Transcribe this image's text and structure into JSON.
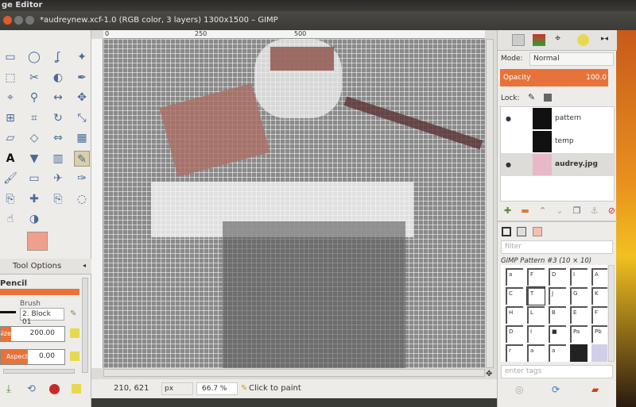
{
  "topbar": {
    "title": "ge Editor"
  },
  "window": {
    "title": "*audreynew.xcf-1.0 (RGB color, 3 layers) 1300x1500 – GIMP"
  },
  "ruler": {
    "marks": [
      "0",
      "250",
      "500"
    ]
  },
  "toolbox": {
    "tool_icons": [
      "rect-select-icon",
      "ellipse-select-icon",
      "lasso-icon",
      "fuzzy-select-icon",
      "color-select-icon",
      "scissors-icon",
      "foreground-select-icon",
      "paths-icon",
      "color-picker-icon",
      "zoom-icon",
      "measure-icon",
      "move-icon",
      "align-icon",
      "crop-icon",
      "rotate-icon",
      "scale-icon",
      "shear-icon",
      "perspective-icon",
      "flip-icon",
      "cage-icon",
      "text-icon",
      "bucket-fill-icon",
      "blend-icon",
      "pencil-icon",
      "paintbrush-icon",
      "eraser-icon",
      "airbrush-icon",
      "ink-icon",
      "clone-icon",
      "heal-icon",
      "perspective-clone-icon",
      "blur-icon",
      "smudge-icon",
      "dodge-burn-icon"
    ],
    "fg_color": "#f0a08a",
    "tool_options_tab": "Tool Options",
    "tool_name": "Pencil",
    "brush_label": "Brush",
    "brush_value": "2. Block 01",
    "size_label": "Size",
    "size_value": "200.00",
    "aspect_label": "Aspect",
    "aspect_value": "0.00"
  },
  "status": {
    "coords": "210, 621",
    "unit": "px",
    "zoom": "66.7 %",
    "message": "Click to paint"
  },
  "layers": {
    "mode_label": "Mode:",
    "mode_value": "Normal",
    "opacity_label": "Opacity",
    "opacity_value": "100.0",
    "lock_label": "Lock:",
    "items": [
      {
        "name": "pattern",
        "visible": true
      },
      {
        "name": "temp",
        "visible": false
      },
      {
        "name": "audrey.jpg",
        "visible": true,
        "selected": true
      }
    ]
  },
  "patterns": {
    "filter_placeholder": "filter",
    "selected_name": "GIMP Pattern #3 (10 × 10)",
    "cells": [
      "a",
      "F",
      "D",
      "I",
      "A",
      "C",
      "T",
      "J",
      "G",
      "K",
      "H",
      "L",
      "B",
      "E",
      "F",
      "D",
      "I",
      "■",
      "Pa",
      "Pb",
      "r",
      "a",
      "a",
      "",
      ""
    ],
    "tags_placeholder": "enter tags"
  },
  "colors": {
    "accent": "#e8733a",
    "canvas_pink": "#b07a6a",
    "canvas_dark": "#6a4040"
  }
}
